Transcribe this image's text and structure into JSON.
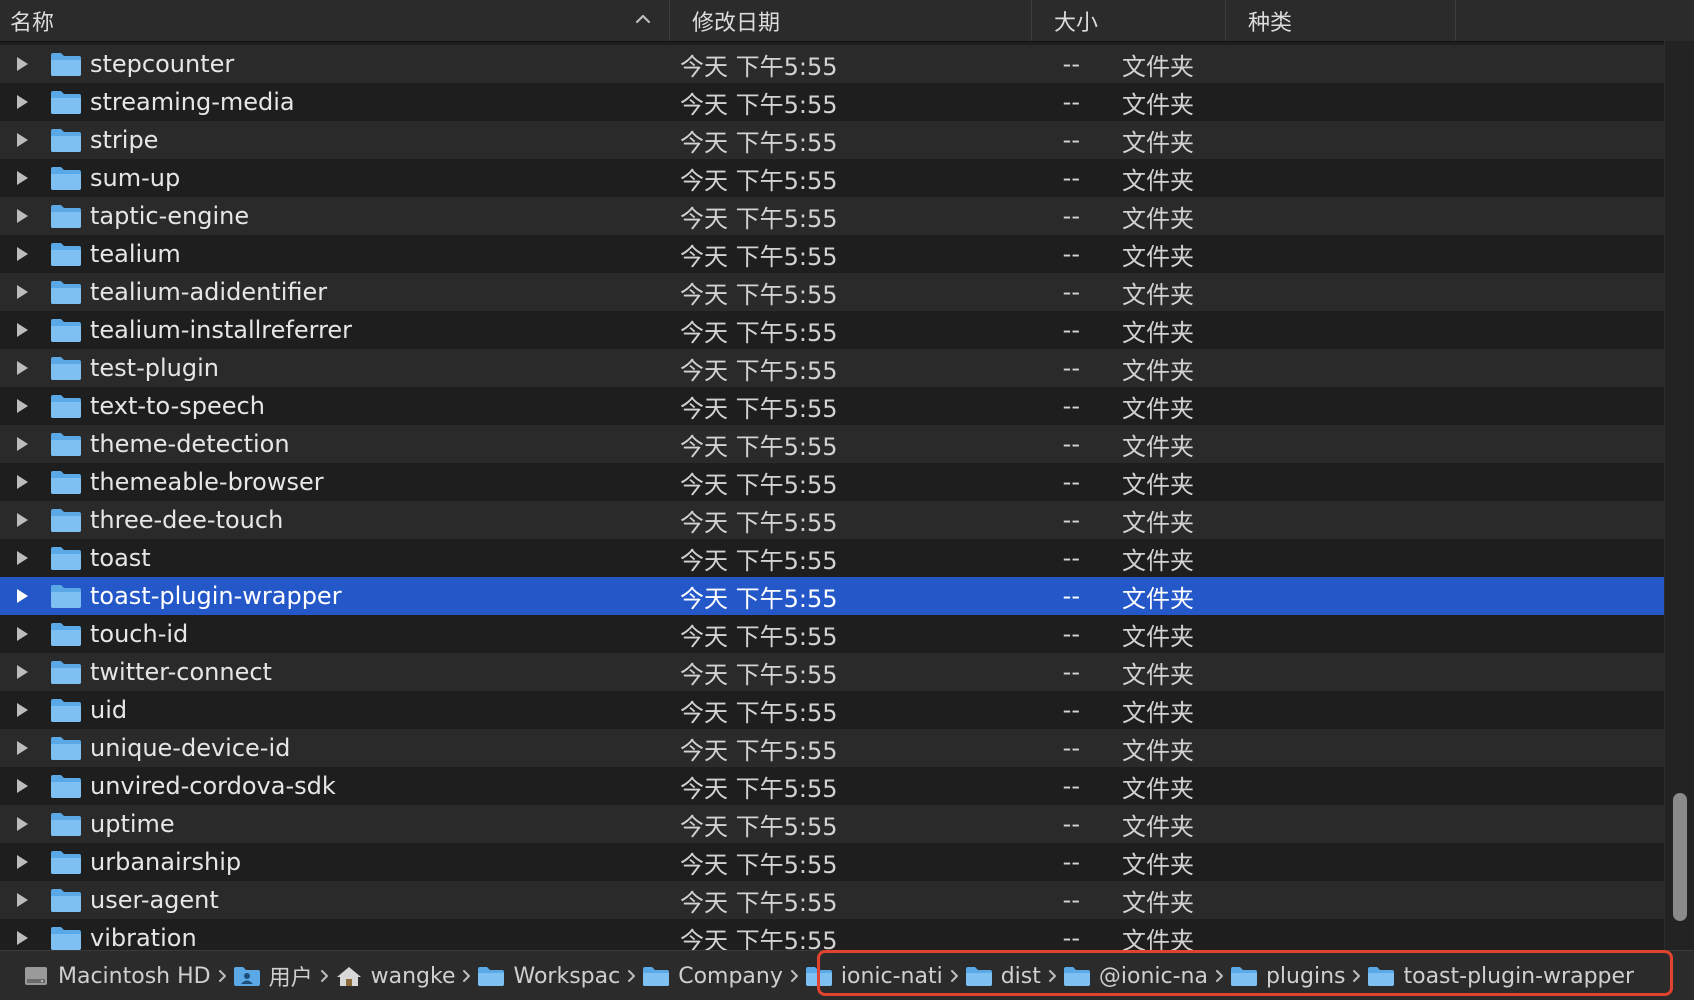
{
  "header": {
    "name": "名称",
    "date_modified": "修改日期",
    "size": "大小",
    "kind": "种类"
  },
  "rows": [
    {
      "name": "stepcounter",
      "date": "今天 下午5:55",
      "size": "--",
      "kind": "文件夹"
    },
    {
      "name": "streaming-media",
      "date": "今天 下午5:55",
      "size": "--",
      "kind": "文件夹"
    },
    {
      "name": "stripe",
      "date": "今天 下午5:55",
      "size": "--",
      "kind": "文件夹"
    },
    {
      "name": "sum-up",
      "date": "今天 下午5:55",
      "size": "--",
      "kind": "文件夹"
    },
    {
      "name": "taptic-engine",
      "date": "今天 下午5:55",
      "size": "--",
      "kind": "文件夹"
    },
    {
      "name": "tealium",
      "date": "今天 下午5:55",
      "size": "--",
      "kind": "文件夹"
    },
    {
      "name": "tealium-adidentifier",
      "date": "今天 下午5:55",
      "size": "--",
      "kind": "文件夹"
    },
    {
      "name": "tealium-installreferrer",
      "date": "今天 下午5:55",
      "size": "--",
      "kind": "文件夹"
    },
    {
      "name": "test-plugin",
      "date": "今天 下午5:55",
      "size": "--",
      "kind": "文件夹"
    },
    {
      "name": "text-to-speech",
      "date": "今天 下午5:55",
      "size": "--",
      "kind": "文件夹"
    },
    {
      "name": "theme-detection",
      "date": "今天 下午5:55",
      "size": "--",
      "kind": "文件夹"
    },
    {
      "name": "themeable-browser",
      "date": "今天 下午5:55",
      "size": "--",
      "kind": "文件夹"
    },
    {
      "name": "three-dee-touch",
      "date": "今天 下午5:55",
      "size": "--",
      "kind": "文件夹"
    },
    {
      "name": "toast",
      "date": "今天 下午5:55",
      "size": "--",
      "kind": "文件夹"
    },
    {
      "name": "toast-plugin-wrapper",
      "date": "今天 下午5:55",
      "size": "--",
      "kind": "文件夹",
      "selected": true
    },
    {
      "name": "touch-id",
      "date": "今天 下午5:55",
      "size": "--",
      "kind": "文件夹"
    },
    {
      "name": "twitter-connect",
      "date": "今天 下午5:55",
      "size": "--",
      "kind": "文件夹"
    },
    {
      "name": "uid",
      "date": "今天 下午5:55",
      "size": "--",
      "kind": "文件夹"
    },
    {
      "name": "unique-device-id",
      "date": "今天 下午5:55",
      "size": "--",
      "kind": "文件夹"
    },
    {
      "name": "unvired-cordova-sdk",
      "date": "今天 下午5:55",
      "size": "--",
      "kind": "文件夹"
    },
    {
      "name": "uptime",
      "date": "今天 下午5:55",
      "size": "--",
      "kind": "文件夹"
    },
    {
      "name": "urbanairship",
      "date": "今天 下午5:55",
      "size": "--",
      "kind": "文件夹"
    },
    {
      "name": "user-agent",
      "date": "今天 下午5:55",
      "size": "--",
      "kind": "文件夹"
    },
    {
      "name": "vibration",
      "date": "今天 下午5:55",
      "size": "--",
      "kind": "文件夹"
    }
  ],
  "pathbar": [
    {
      "label": "Macintosh HD",
      "icon": "hard-drive-icon"
    },
    {
      "label": "用户",
      "icon": "users-folder-icon"
    },
    {
      "label": "wangke",
      "icon": "home-icon"
    },
    {
      "label": "Workspac",
      "icon": "folder-icon"
    },
    {
      "label": "Company",
      "icon": "folder-icon"
    },
    {
      "label": "ionic-nati",
      "icon": "folder-icon"
    },
    {
      "label": "dist",
      "icon": "folder-icon"
    },
    {
      "label": "@ionic-na",
      "icon": "folder-icon"
    },
    {
      "label": "plugins",
      "icon": "folder-icon"
    },
    {
      "label": "toast-plugin-wrapper",
      "icon": "folder-icon"
    }
  ],
  "colors": {
    "selection": "#2458c9",
    "folder": "#5aa9e6",
    "highlight_box": "#e0432f"
  }
}
